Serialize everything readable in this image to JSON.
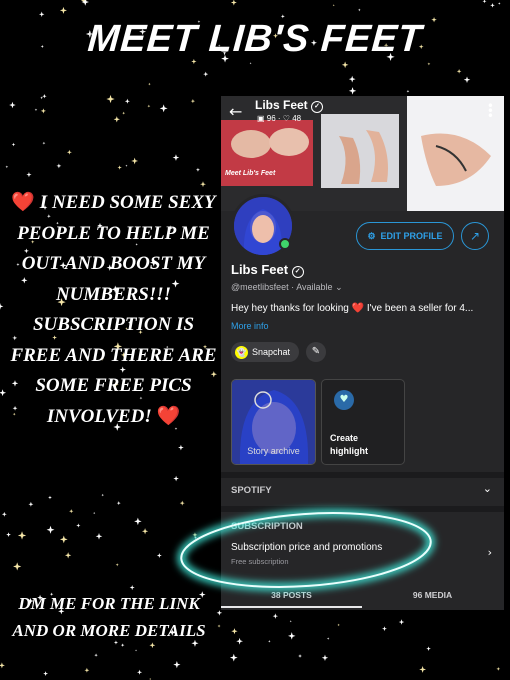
{
  "headline": "MEET LIB'S FEET",
  "left_message": {
    "heart": "❤️",
    "text": "I NEED SOME SEXY PEOPLE TO HELP ME OUT AND BOOST MY NUMBERS!!! SUBSCRIPTION IS FREE AND THERE ARE SOME FREE PICS INVOLVED!"
  },
  "left_bottom": "DM ME FOR THE LINK AND OR MORE DETAILS",
  "profile": {
    "header_name": "Libs Feet",
    "photos_count": "96",
    "likes_count": "48",
    "cover_caption": "Meet Lib's Feet",
    "edit_profile_label": "EDIT PROFILE",
    "display_name": "Libs Feet",
    "handle": "@meetlibsfeet",
    "status": "Available",
    "bio": "Hey hey thanks for looking ❤️ I've been a seller for 4...",
    "more_info": "More info",
    "snapchat_label": "Snapchat",
    "story_label": "Story archive",
    "highlight_label_1": "Create",
    "highlight_label_2": "highlight",
    "spotify_title": "SPOTIFY",
    "subscription_title": "SUBSCRIPTION",
    "subscription_row_title": "Subscription price and promotions",
    "subscription_row_sub": "Free subscription",
    "tab_posts": "38 POSTS",
    "tab_media": "96 MEDIA"
  },
  "colors": {
    "accent_blue": "#2ea0e8",
    "glow_teal": "#3ff0e0",
    "panel_bg": "#262628",
    "heart_red": "#e0483e"
  }
}
